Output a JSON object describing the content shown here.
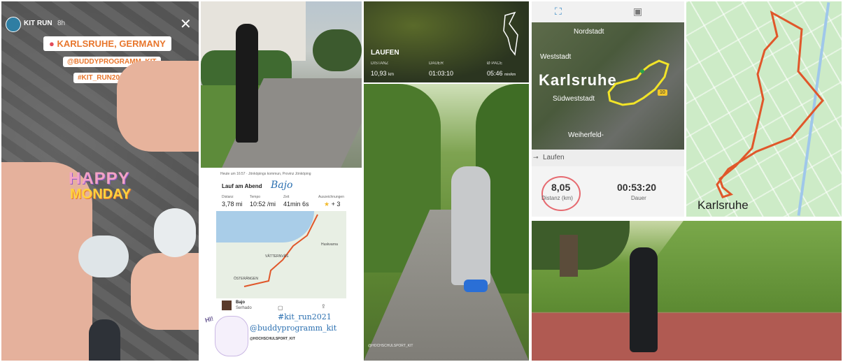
{
  "story": {
    "account": "KIT RUN",
    "time": "8h",
    "location": "KARLSRUHE, GERMANY",
    "mention": "@BUDDYPROGRAMM_KIT",
    "hashtag": "#KIT_RUN2021",
    "greeting_line1": "HAPPY",
    "greeting_line2": "MONDAY"
  },
  "run_tile": {
    "title": "LAUFEN",
    "distance_label": "DISTANZ",
    "distance_value": "10,93",
    "distance_unit": "km",
    "duration_label": "DAUER",
    "duration_value": "01:03:10",
    "pace_label": "Ø PACE",
    "pace_value": "05:46",
    "pace_unit": "min/km"
  },
  "strava_tile": {
    "header": "Heute um 16:57 · Jönköpings kommun, Provinz Jönköping",
    "activity_title": "Lauf am Abend",
    "handwriting": "Bajo",
    "col1_label": "Distanz",
    "col1_value": "3,78 mi",
    "col2_label": "Tempo",
    "col2_value": "10:52 /mi",
    "col3_label": "Zeit",
    "col3_value": "41min 6s",
    "col4_label": "Auszeichnungen",
    "col4_value": "3",
    "map_label1": "Huskvarna",
    "map_label2": "VÄTTERNVÄS",
    "map_label3": "ÖSTERÄNGEN",
    "song_title": "Bajo",
    "song_artist": "Serhado",
    "tag1": "#kit_run2021",
    "tag2": "@buddyprogramm_kit",
    "tag3": "@HOCHSCHULSPORT_KIT",
    "bunny_text": "HI!"
  },
  "trail_tile": {
    "watermark": "@HOCHSCHULSPORT_KIT"
  },
  "karlsruhe_app": {
    "map_label1": "Nordstadt",
    "map_label2": "Weststadt",
    "map_label3": "Karlsruhe",
    "map_label4": "Südweststadt",
    "map_label5": "Weiherfeld-",
    "marker": "10",
    "activity": "Laufen",
    "distance_value": "8,05",
    "distance_label": "Distanz (km)",
    "duration_value": "00:53:20",
    "duration_label": "Dauer"
  },
  "karlsruhe_map": {
    "city_label": "Karlsruhe"
  },
  "colors": {
    "route_orange": "#e0572a",
    "route_yellow": "#f2e428",
    "sticker_orange": "#e8762c",
    "sticker_red": "#e24b5a",
    "sticker_purple": "#8f58c9",
    "map_green": "#cdebc7"
  }
}
